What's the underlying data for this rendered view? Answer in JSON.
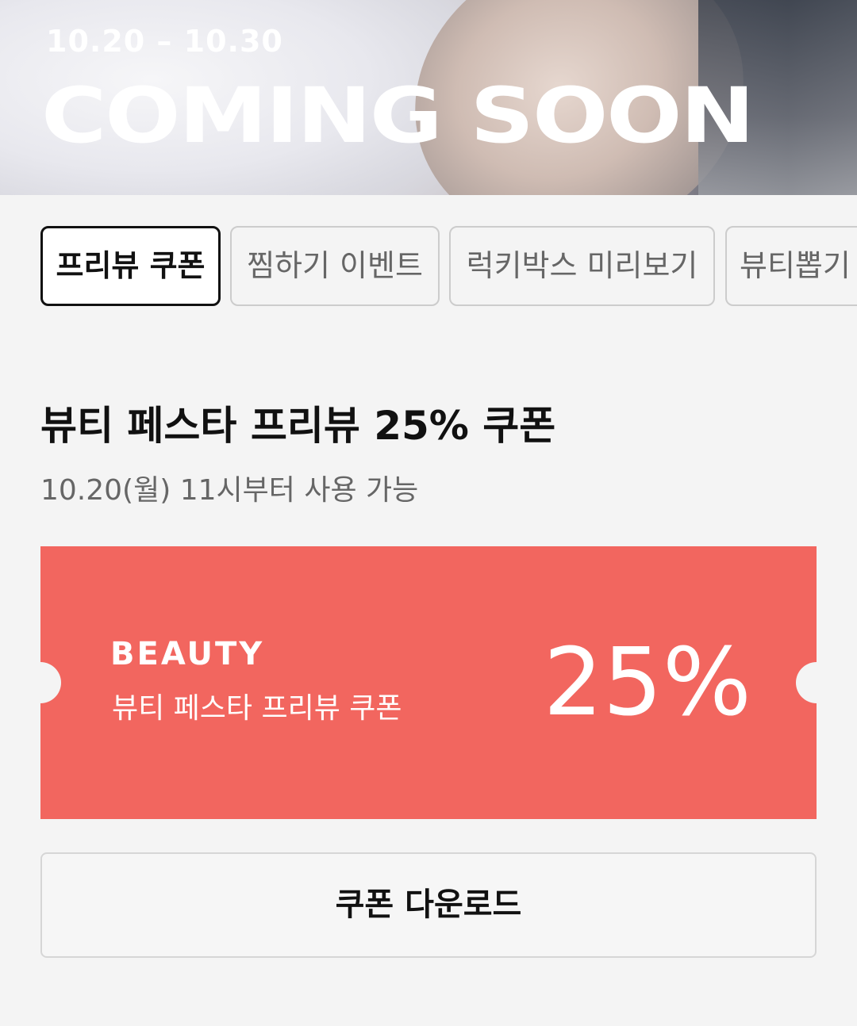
{
  "hero": {
    "date_range": "10.20 – 10.30",
    "title": "COMING SOON"
  },
  "tabs": [
    {
      "label": "프리뷰 쿠폰",
      "active": true
    },
    {
      "label": "찜하기 이벤트",
      "active": false
    },
    {
      "label": "럭키박스 미리보기",
      "active": false
    },
    {
      "label": "뷰티뽑기",
      "active": false
    }
  ],
  "section": {
    "title": "뷰티 페스타 프리뷰 25% 쿠폰",
    "subtitle": "10.20(월) 11시부터 사용 가능"
  },
  "coupon": {
    "brand": "BEAUTY",
    "name": "뷰티 페스타 프리뷰 쿠폰",
    "value": "25%",
    "color": "#f2665f"
  },
  "download_button": {
    "label": "쿠폰 다운로드"
  }
}
